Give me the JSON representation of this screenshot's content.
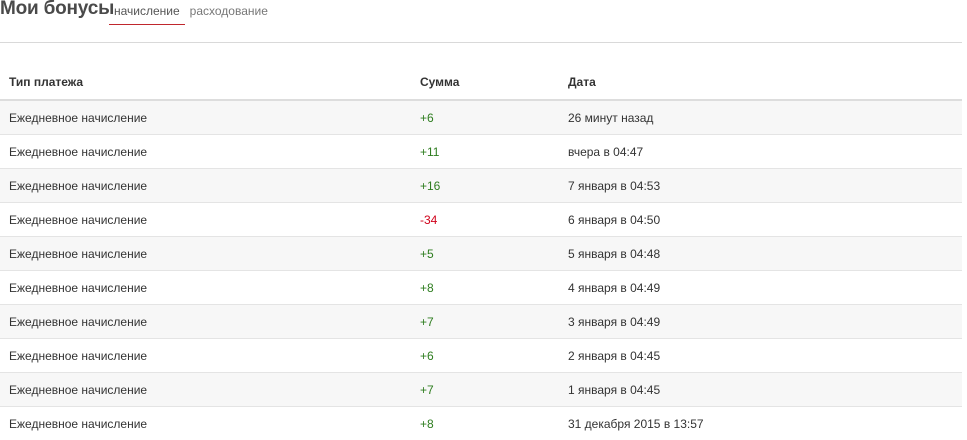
{
  "page": {
    "title": "Мои бонусы"
  },
  "tabs": [
    {
      "label": "начисление",
      "active": true
    },
    {
      "label": "расходование",
      "active": false
    }
  ],
  "colors": {
    "accent": "#c0272d",
    "positive": "#2e7d1f",
    "negative": "#d0021b"
  },
  "table": {
    "headers": {
      "type": "Тип платежа",
      "sum": "Сумма",
      "date": "Дата"
    },
    "rows": [
      {
        "type": "Ежедневное начисление",
        "sum": "+6",
        "date": "26 минут назад"
      },
      {
        "type": "Ежедневное начисление",
        "sum": "+11",
        "date": "вчера в 04:47"
      },
      {
        "type": "Ежедневное начисление",
        "sum": "+16",
        "date": "7 января в 04:53"
      },
      {
        "type": "Ежедневное начисление",
        "sum": "-34",
        "date": "6 января в 04:50"
      },
      {
        "type": "Ежедневное начисление",
        "sum": "+5",
        "date": "5 января в 04:48"
      },
      {
        "type": "Ежедневное начисление",
        "sum": "+8",
        "date": "4 января в 04:49"
      },
      {
        "type": "Ежедневное начисление",
        "sum": "+7",
        "date": "3 января в 04:49"
      },
      {
        "type": "Ежедневное начисление",
        "sum": "+6",
        "date": "2 января в 04:45"
      },
      {
        "type": "Ежедневное начисление",
        "sum": "+7",
        "date": "1 января в 04:45"
      },
      {
        "type": "Ежедневное начисление",
        "sum": "+8",
        "date": "31 декабря 2015 в 13:57"
      }
    ]
  }
}
